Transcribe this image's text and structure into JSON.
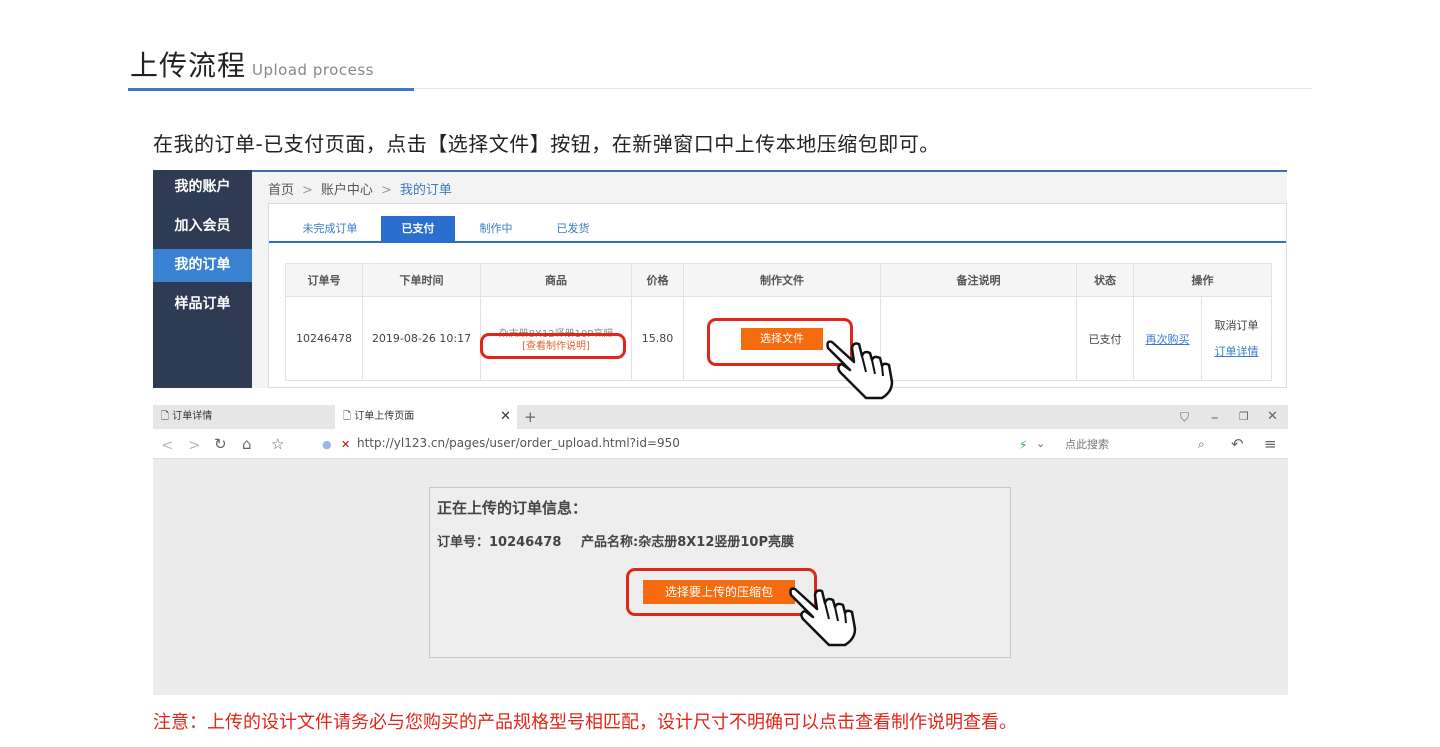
{
  "header": {
    "title": "上传流程",
    "subtitle": "Upload process"
  },
  "intro": "在我的订单-已支付页面，点击【选择文件】按钮，在新弹窗口中上传本地压缩包即可。",
  "sidebar": {
    "items": [
      {
        "label": "我的账户"
      },
      {
        "label": "加入会员"
      },
      {
        "label": "我的订单"
      },
      {
        "label": "样品订单"
      }
    ]
  },
  "breadcrumb": {
    "home": "首页",
    "account": "账户中心",
    "current": "我的订单"
  },
  "tabs": [
    {
      "label": "未完成订单"
    },
    {
      "label": "已支付"
    },
    {
      "label": "制作中"
    },
    {
      "label": "已发货"
    }
  ],
  "table": {
    "headers": [
      "订单号",
      "下单时间",
      "商品",
      "价格",
      "制作文件",
      "备注说明",
      "状态",
      "操作"
    ],
    "row": {
      "order_no": "10246478",
      "time": "2019-08-26 10:17",
      "product": "杂志册8X12竖册10P亮膜",
      "view_instructions": "[查看制作说明]",
      "price": "15.80",
      "choose_file": "选择文件",
      "note": "",
      "status": "已支付",
      "rebuy": "再次购买",
      "cancel": "取消订单",
      "details": "订单详情"
    }
  },
  "browser": {
    "tab1": "订单详情",
    "tab2": "订单上传页面",
    "url": "http://yl123.cn/pages/user/order_upload.html?id=950",
    "search_placeholder": "点此搜索"
  },
  "dialog": {
    "title": "正在上传的订单信息：",
    "order": "订单号：10246478",
    "product": "产品名称:杂志册8X12竖册10P亮膜",
    "button": "选择要上传的压缩包"
  },
  "notice": "注意：上传的设计文件请务必与您购买的产品规格型号相匹配，设计尺寸不明确可以点击查看制作说明查看。",
  "colors": {
    "accent": "#3a7bc8",
    "sidebar": "#2e3b52",
    "orange": "#f56b10",
    "highlight": "#e0261b"
  }
}
